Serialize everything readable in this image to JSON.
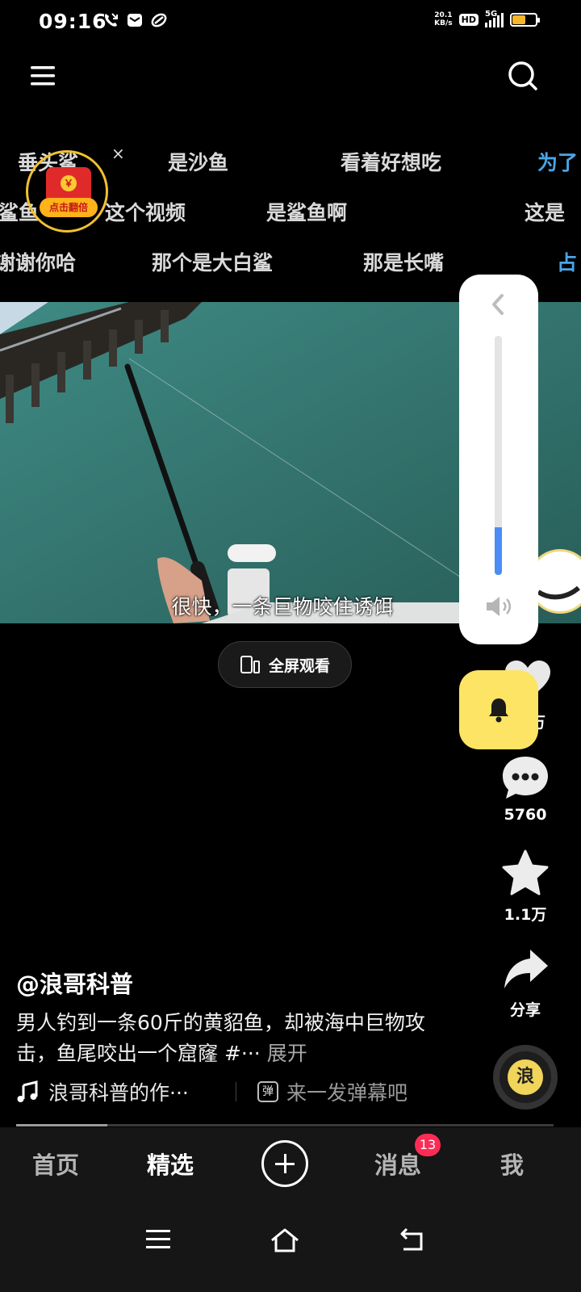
{
  "status_bar": {
    "time": "09:16",
    "net_speed_value": "20.1",
    "net_speed_unit": "KB/s",
    "hd": "HD",
    "network": "5G",
    "battery_percent": 60,
    "icons": [
      "missed-call-icon",
      "mail-icon",
      "link-icon"
    ]
  },
  "top_nav": {
    "menu_icon": "menu-icon",
    "search_icon": "search-icon"
  },
  "danmaku": [
    {
      "text": "垂头鲨"
    },
    {
      "text": "是沙鱼"
    },
    {
      "text": "看着好想吃"
    },
    {
      "text": "为了"
    },
    {
      "text": "鲨鱼"
    },
    {
      "text": "这个视频"
    },
    {
      "text": "是鲨鱼啊"
    },
    {
      "text": "这是"
    },
    {
      "text": "谢谢你哈"
    },
    {
      "text": "那个是大白鲨"
    },
    {
      "text": "那是长嘴"
    },
    {
      "text": "占"
    }
  ],
  "red_packet": {
    "coin": "￥",
    "label": "点击翻倍",
    "close": "×"
  },
  "video": {
    "subtitle": "很快，一条巨物咬住诱饵"
  },
  "fullscreen_button": {
    "label": "全屏观看"
  },
  "volume": {
    "level_fraction": 0.2
  },
  "rail": {
    "like_count": "万",
    "comment_count": "5760",
    "favorite_count": "1.1万",
    "share_label": "分享",
    "disc_char": "浪"
  },
  "post": {
    "author": "@浪哥科普",
    "description": "男人钓到一条60斤的黄貂鱼，却被海中巨物攻击，鱼尾咬出一个窟窿  #···",
    "expand": "展开",
    "music": "浪哥科普的作···",
    "danmu_icon": "弹",
    "danmu_placeholder": "来一发弹幕吧",
    "progress_fraction": 0.17
  },
  "tabs": [
    {
      "label": "首页",
      "active": false
    },
    {
      "label": "精选",
      "active": true
    },
    {
      "label": "消息",
      "active": false
    },
    {
      "label": "我",
      "active": false
    }
  ],
  "messages_badge": "13",
  "colors": {
    "badge": "#fe2c55",
    "bell_bg": "#fde464",
    "volume": "#4b8df5",
    "battery": "#f5b62b"
  }
}
